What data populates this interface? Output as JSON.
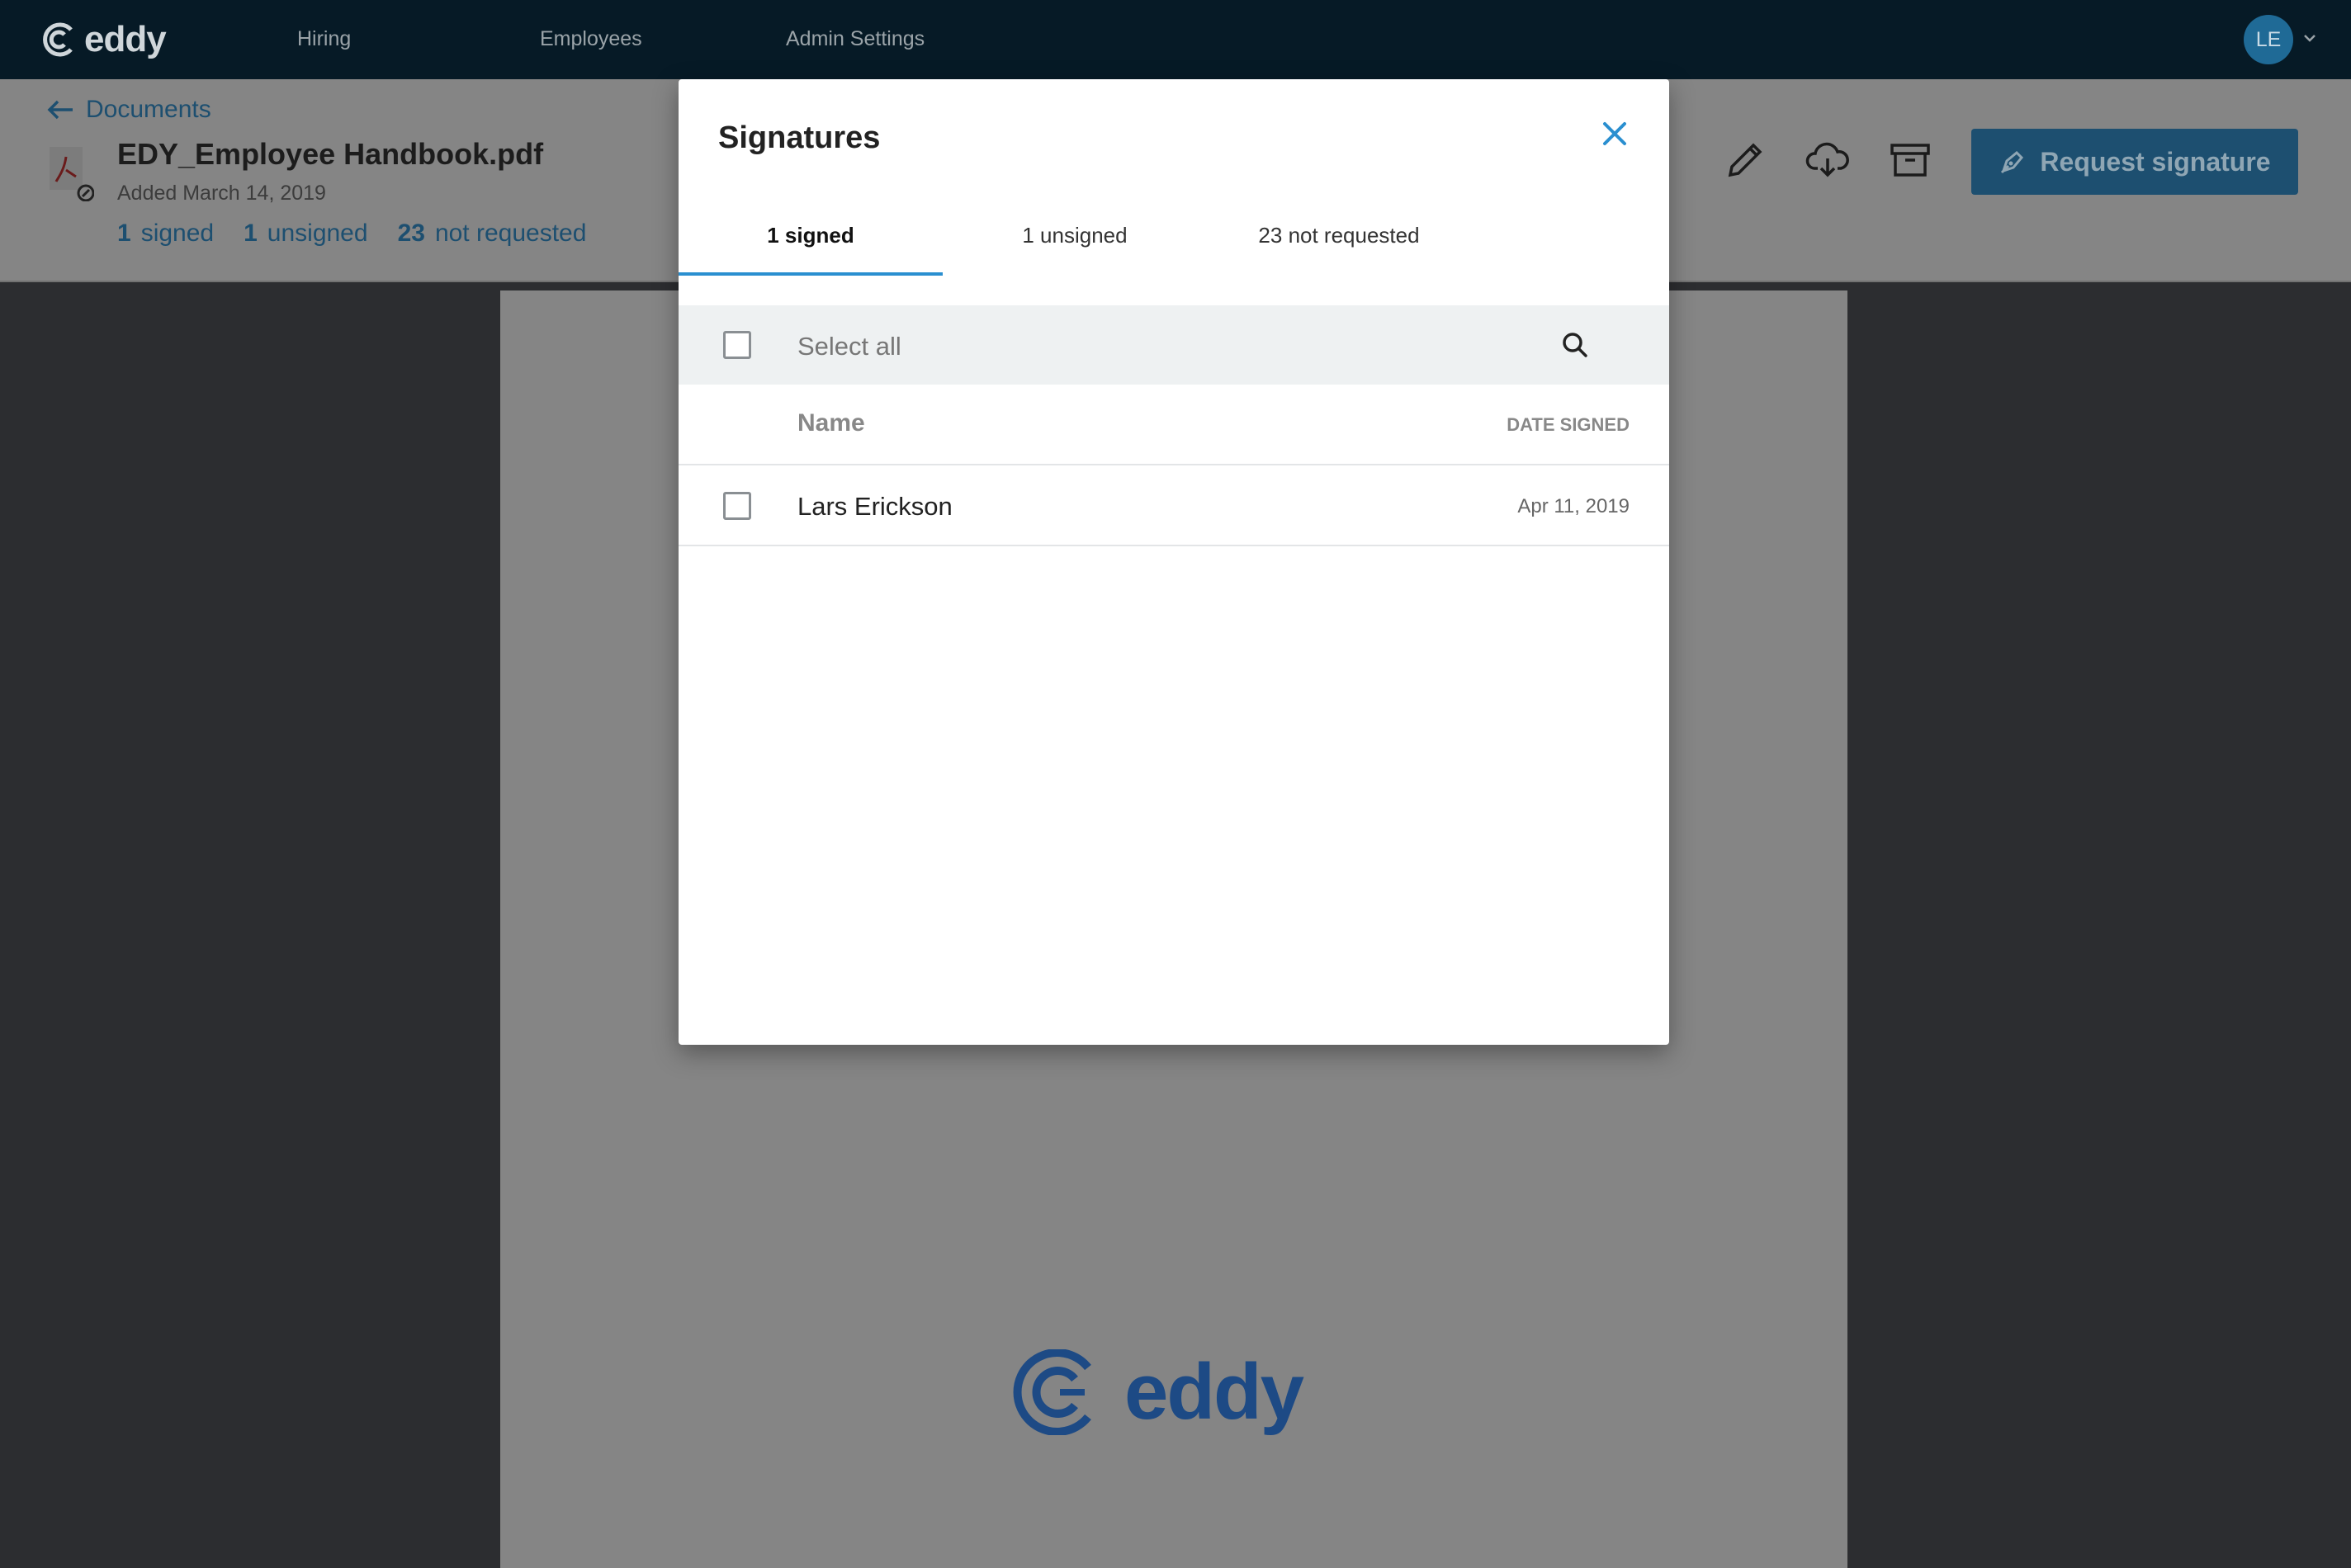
{
  "nav": {
    "logo_text": "eddy",
    "links": [
      "Hiring",
      "Employees",
      "Admin Settings"
    ],
    "avatar_initials": "LE"
  },
  "doc": {
    "back_label": "Documents",
    "title": "EDY_Employee Handbook.pdf",
    "added": "Added March 14, 2019",
    "counts": {
      "signed_num": "1",
      "signed_label": "signed",
      "unsigned_num": "1",
      "unsigned_label": "unsigned",
      "notreq_num": "23",
      "notreq_label": "not requested"
    },
    "request_button": "Request signature"
  },
  "page_logo_text": "eddy",
  "modal": {
    "title": "Signatures",
    "tabs": [
      "1 signed",
      "1 unsigned",
      "23 not requested"
    ],
    "active_tab": 0,
    "select_all": "Select all",
    "columns": {
      "name": "Name",
      "date": "DATE SIGNED"
    },
    "rows": [
      {
        "name": "Lars Erickson",
        "date": "Apr 11, 2019"
      }
    ]
  },
  "colors": {
    "accent": "#2a8fd0",
    "nav_bg": "#061a26",
    "button_bg": "#1d4f70",
    "logo_blue": "#1d4a85"
  },
  "icons": [
    "eddy-logo-icon",
    "arrow-left-icon",
    "pdf-file-icon",
    "pen-sign-icon",
    "pencil-icon",
    "cloud-download-icon",
    "archive-icon",
    "chevron-down-icon",
    "close-icon",
    "search-icon"
  ]
}
